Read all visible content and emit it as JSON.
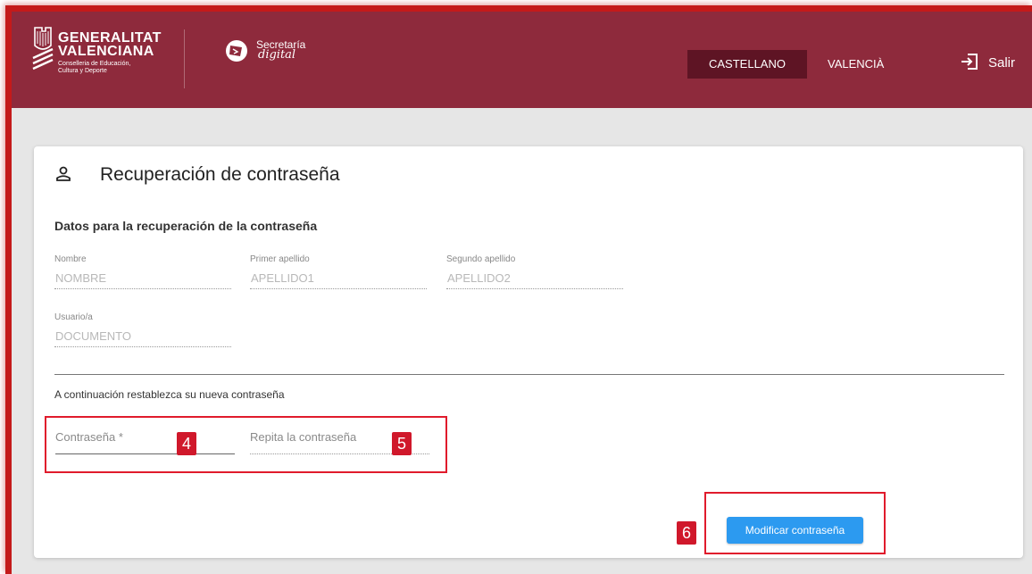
{
  "header": {
    "org_title_line1": "GENERALITAT",
    "org_title_line2": "VALENCIANA",
    "org_sub_line1": "Conselleria de Educación,",
    "org_sub_line2": "Cultura y Deporte",
    "app_name_line1": "Secretaría",
    "app_name_line2": "digital",
    "languages": [
      "CASTELLANO",
      "VALENCIÀ"
    ],
    "active_language": "CASTELLANO",
    "exit_label": "Salir"
  },
  "card": {
    "title": "Recuperación de contraseña",
    "section_title": "Datos para la recuperación de la contraseña",
    "fields": [
      {
        "label": "Nombre",
        "value": "NOMBRE"
      },
      {
        "label": "Primer apellido",
        "value": "APELLIDO1"
      },
      {
        "label": "Segundo apellido",
        "value": "APELLIDO2"
      },
      {
        "label": "Usuario/a",
        "value": "DOCUMENTO"
      }
    ],
    "instruction": "A continuación restablezca su nueva contraseña",
    "password_placeholder": "Contraseña *",
    "repeat_placeholder": "Repita la contraseña",
    "submit_label": "Modificar contraseña"
  },
  "annotations": {
    "badge_4": "4",
    "badge_5": "5",
    "badge_6": "6"
  },
  "colors": {
    "header_bg": "#8e2a3c",
    "active_lang_bg": "#5e1424",
    "button_bg": "#2c9af0",
    "annotation_red": "#e01b2c"
  },
  "icons": {
    "user": "user-icon",
    "exit": "exit-icon"
  }
}
